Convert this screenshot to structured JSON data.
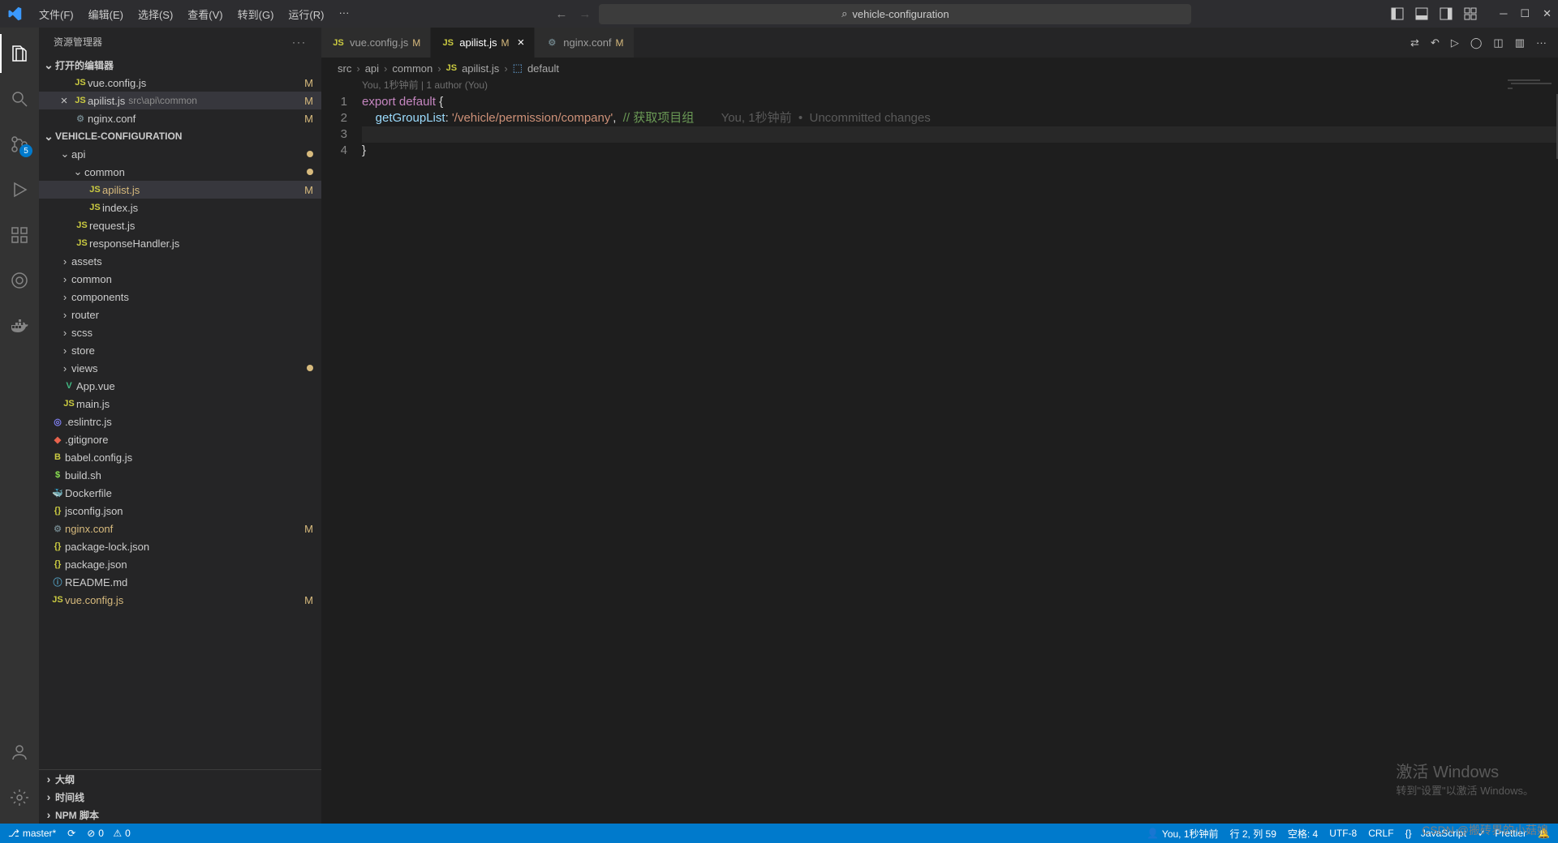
{
  "titlebar": {
    "menus": [
      "文件(F)",
      "编辑(E)",
      "选择(S)",
      "查看(V)",
      "转到(G)",
      "运行(R)",
      "···"
    ],
    "search_placeholder": "vehicle-configuration"
  },
  "sidebar": {
    "title": "资源管理器",
    "open_editors_label": "打开的编辑器",
    "open_files": [
      {
        "name": "vue.config.js",
        "icon": "JS",
        "iconcls": "js",
        "mod": "M",
        "active": false
      },
      {
        "name": "apilist.js",
        "icon": "JS",
        "iconcls": "js",
        "mod": "M",
        "path": "src\\api\\common",
        "active": true
      },
      {
        "name": "nginx.conf",
        "icon": "⚙",
        "iconcls": "gear",
        "mod": "M",
        "active": false
      }
    ],
    "project_label": "VEHICLE-CONFIGURATION",
    "tree": {
      "api": "api",
      "common": "common",
      "apilist": "apilist.js",
      "index": "index.js",
      "request": "request.js",
      "responseHandler": "responseHandler.js",
      "assets": "assets",
      "common2": "common",
      "components": "components",
      "router": "router",
      "scss": "scss",
      "store": "store",
      "views": "views",
      "appvue": "App.vue",
      "mainjs": "main.js",
      "eslintrc": ".eslintrc.js",
      "gitignore": ".gitignore",
      "babel": "babel.config.js",
      "build": "build.sh",
      "docker": "Dockerfile",
      "jsconfig": "jsconfig.json",
      "nginx": "nginx.conf",
      "pkglock": "package-lock.json",
      "pkg": "package.json",
      "readme": "README.md",
      "vuecfg": "vue.config.js"
    },
    "outline": "大纲",
    "timeline": "时间线",
    "npm": "NPM 脚本"
  },
  "tabs": [
    {
      "name": "vue.config.js",
      "icon": "JS",
      "iconcls": "js",
      "mod": "M",
      "active": false,
      "close": false
    },
    {
      "name": "apilist.js",
      "icon": "JS",
      "iconcls": "js",
      "mod": "M",
      "active": true,
      "close": true
    },
    {
      "name": "nginx.conf",
      "icon": "⚙",
      "iconcls": "gear",
      "mod": "M",
      "active": false,
      "close": false
    }
  ],
  "breadcrumbs": [
    "src",
    "api",
    "common",
    "apilist.js",
    "default"
  ],
  "editor": {
    "blame_header": "You, 1秒钟前 | 1 author (You)",
    "line1": {
      "export": "export",
      "default": "default",
      "brace": " {"
    },
    "line2": {
      "prop": "getGroupList",
      "colon": ": ",
      "str": "'/vehicle/permission/company'",
      "comma": ",  ",
      "comment": "// 获取项目组",
      "blame": "        You, 1秒钟前  •  Uncommitted changes"
    },
    "line4": "}",
    "linenos": [
      "1",
      "2",
      "3",
      "4"
    ]
  },
  "statusbar": {
    "branch": "master*",
    "errors": "0",
    "warns": "0",
    "blame": "You, 1秒钟前",
    "pos": "行 2, 列 59",
    "spaces": "空格: 4",
    "enc": "UTF-8",
    "eol": "CRLF",
    "lang": "JavaScript",
    "prettier": "Prettier",
    "bell": ""
  },
  "badges": {
    "scm": "5"
  },
  "watermark": {
    "l1": "激活 Windows",
    "l2": "转到\"设置\"以激活 Windows。"
  },
  "csdn": "CSDN @搬砖界的小菇娘"
}
